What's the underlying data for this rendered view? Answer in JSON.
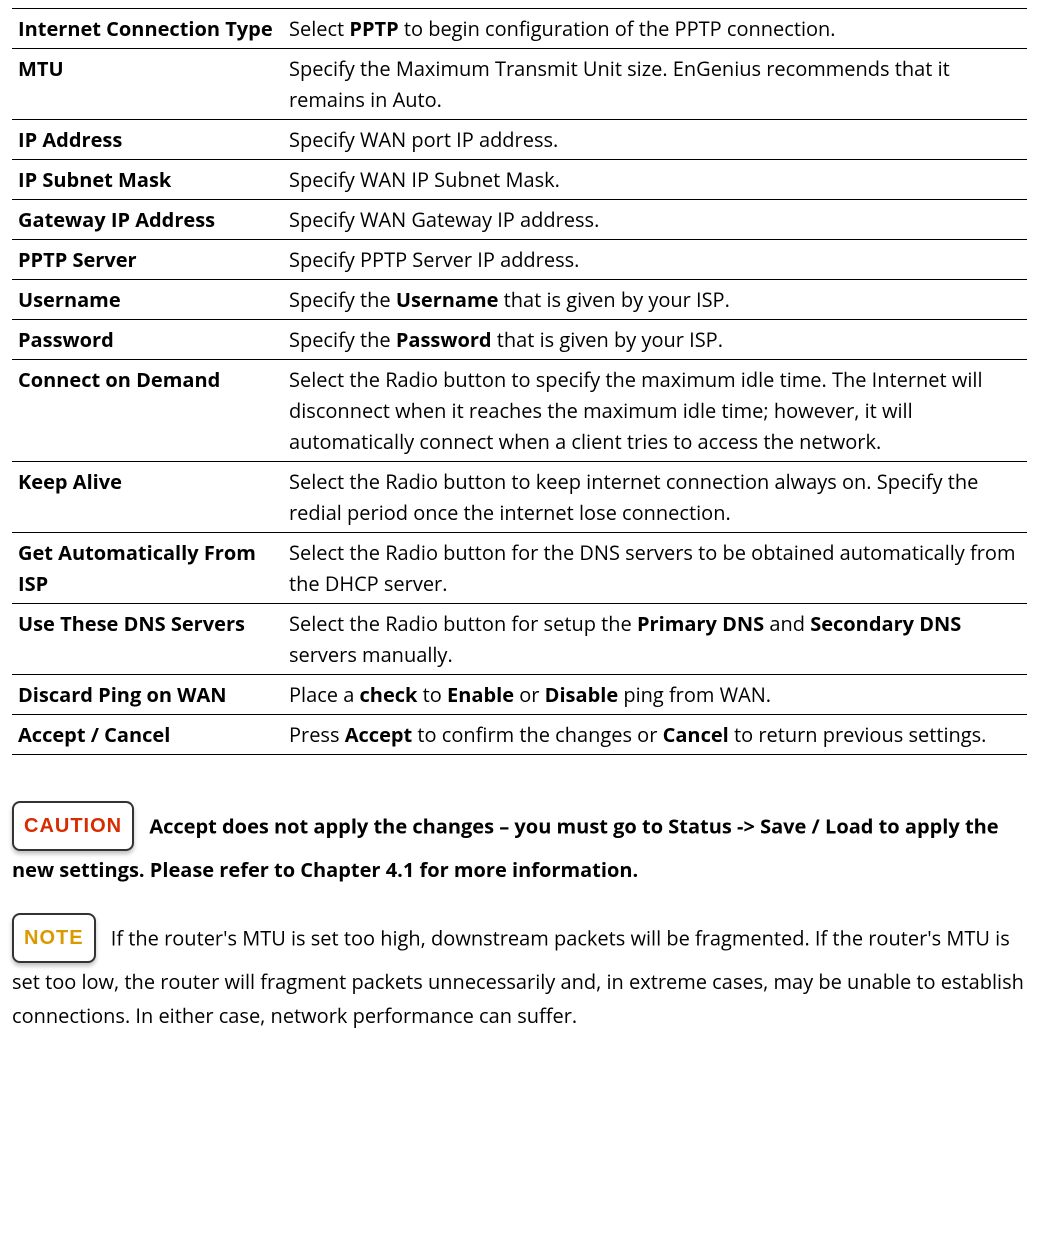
{
  "rows": [
    {
      "label": "Internet Connection Type",
      "desc": "Select <b>PPTP</b> to begin configuration of the PPTP connection."
    },
    {
      "label": "MTU",
      "desc": "Specify the Maximum Transmit Unit size. EnGenius recommends that it remains in Auto."
    },
    {
      "label": "IP Address",
      "desc": "Specify WAN port IP address."
    },
    {
      "label": "IP Subnet Mask",
      "desc": "Specify WAN IP Subnet Mask."
    },
    {
      "label": "Gateway IP Address",
      "desc": "Specify WAN Gateway IP address."
    },
    {
      "label": "PPTP Server",
      "desc": "Specify PPTP Server IP address."
    },
    {
      "label": "Username",
      "desc": "Specify the <b>Username</b> that is given by your ISP."
    },
    {
      "label": "Password",
      "desc": "Specify the <b>Password</b> that is given by your ISP."
    },
    {
      "label": "Connect on Demand",
      "desc": "Select the Radio button to specify the maximum idle time. The Internet will disconnect when it reaches the maximum idle time; however, it will automatically connect when a client tries to access the network."
    },
    {
      "label": "Keep Alive",
      "desc": "Select the Radio button to keep internet connection always on. Specify the redial period once the internet lose connection."
    },
    {
      "label": "Get Automatically From ISP",
      "desc": "Select the Radio button for the DNS servers to be obtained automatically from the DHCP server."
    },
    {
      "label": "Use These DNS Servers",
      "desc": "Select the Radio button for setup the <b>Primary DNS</b> and <b>Secondary DNS</b> servers manually."
    },
    {
      "label": "Discard Ping on WAN",
      "desc": "Place a <b>check</b> to <b>Enable</b> or <b>Disable</b> ping from WAN."
    },
    {
      "label": "Accept / Cancel",
      "desc": "Press <b>Accept</b> to confirm the changes or <b>Cancel</b> to return previous settings."
    }
  ],
  "caution": {
    "badge": "CAUTION",
    "text": "<b>Accept does not apply the changes – you must go to Status -&gt; Save / Load to apply the new settings. Please refer to Chapter 4.1 for more information.</b>"
  },
  "note": {
    "badge": "NOTE",
    "text": "If the router's MTU is set too high, downstream packets will be fragmented. If the router's MTU is set too low, the router will fragment packets unnecessarily and, in extreme cases, may be unable to establish connections. In either case, network performance can suffer."
  }
}
